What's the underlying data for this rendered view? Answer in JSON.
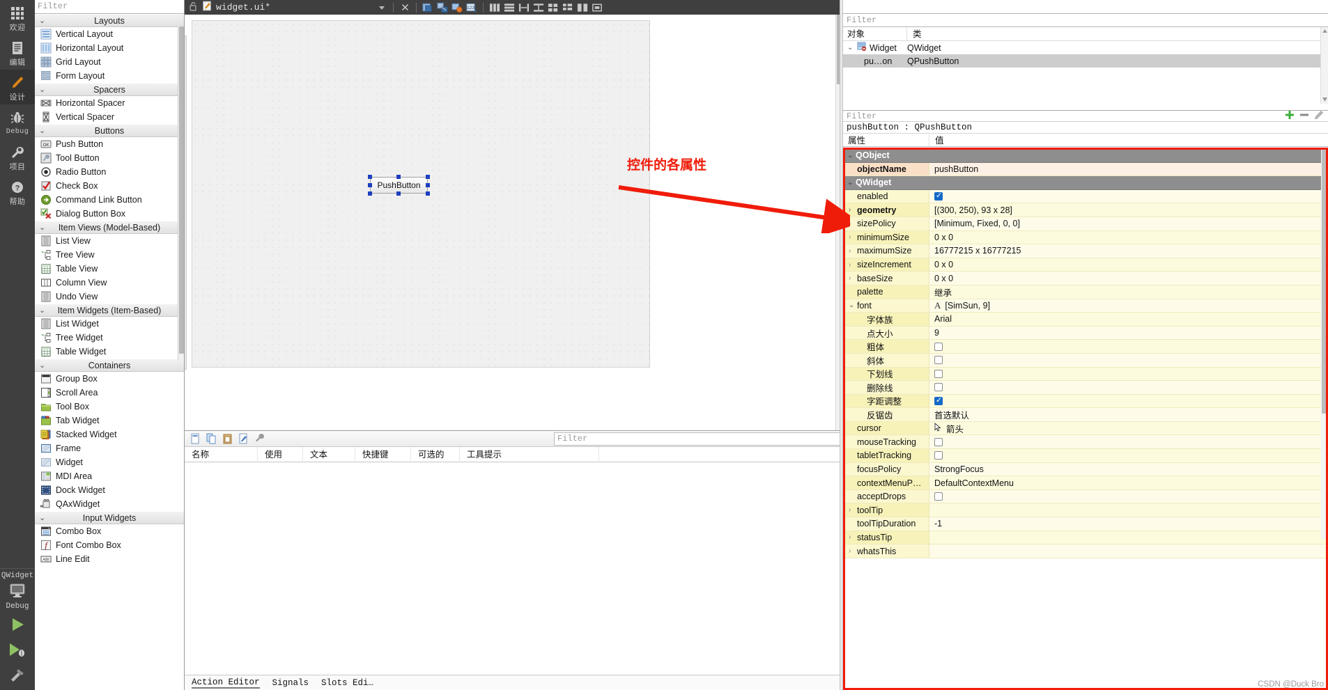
{
  "modebar": {
    "items": [
      {
        "label": "欢迎",
        "icon": "grid-icon",
        "active": false
      },
      {
        "label": "编辑",
        "icon": "document-icon",
        "active": false
      },
      {
        "label": "设计",
        "icon": "pencil-icon",
        "active": true
      },
      {
        "label": "Debug",
        "icon": "bug-icon",
        "active": false
      },
      {
        "label": "项目",
        "icon": "wrench-icon",
        "active": false
      },
      {
        "label": "帮助",
        "icon": "question-icon",
        "active": false
      }
    ],
    "kit": {
      "name": "QWidget",
      "build_config": "Debug",
      "icon": "monitor-icon"
    },
    "run_buttons": [
      {
        "name": "run-button",
        "icon": "play-icon"
      },
      {
        "name": "debug-button",
        "icon": "play-bug-icon"
      },
      {
        "name": "build-button",
        "icon": "hammer-icon"
      }
    ]
  },
  "widgetbox": {
    "filter_placeholder": "Filter",
    "groups": [
      {
        "title": "Layouts",
        "items": [
          {
            "label": "Vertical Layout",
            "icon": "vertical-layout-icon"
          },
          {
            "label": "Horizontal Layout",
            "icon": "horizontal-layout-icon"
          },
          {
            "label": "Grid Layout",
            "icon": "grid-layout-icon"
          },
          {
            "label": "Form Layout",
            "icon": "form-layout-icon"
          }
        ]
      },
      {
        "title": "Spacers",
        "items": [
          {
            "label": "Horizontal Spacer",
            "icon": "horizontal-spacer-icon"
          },
          {
            "label": "Vertical Spacer",
            "icon": "vertical-spacer-icon"
          }
        ]
      },
      {
        "title": "Buttons",
        "items": [
          {
            "label": "Push Button",
            "icon": "push-button-icon"
          },
          {
            "label": "Tool Button",
            "icon": "tool-button-icon"
          },
          {
            "label": "Radio Button",
            "icon": "radio-button-icon"
          },
          {
            "label": "Check Box",
            "icon": "check-box-icon"
          },
          {
            "label": "Command Link Button",
            "icon": "command-link-icon"
          },
          {
            "label": "Dialog Button Box",
            "icon": "dialog-button-box-icon"
          }
        ]
      },
      {
        "title": "Item Views (Model-Based)",
        "items": [
          {
            "label": "List View",
            "icon": "list-view-icon"
          },
          {
            "label": "Tree View",
            "icon": "tree-view-icon"
          },
          {
            "label": "Table View",
            "icon": "table-view-icon"
          },
          {
            "label": "Column View",
            "icon": "column-view-icon"
          },
          {
            "label": "Undo View",
            "icon": "undo-view-icon"
          }
        ]
      },
      {
        "title": "Item Widgets (Item-Based)",
        "items": [
          {
            "label": "List Widget",
            "icon": "list-widget-icon"
          },
          {
            "label": "Tree Widget",
            "icon": "tree-widget-icon"
          },
          {
            "label": "Table Widget",
            "icon": "table-widget-icon"
          }
        ]
      },
      {
        "title": "Containers",
        "items": [
          {
            "label": "Group Box",
            "icon": "group-box-icon"
          },
          {
            "label": "Scroll Area",
            "icon": "scroll-area-icon"
          },
          {
            "label": "Tool Box",
            "icon": "tool-box-icon"
          },
          {
            "label": "Tab Widget",
            "icon": "tab-widget-icon"
          },
          {
            "label": "Stacked Widget",
            "icon": "stacked-widget-icon"
          },
          {
            "label": "Frame",
            "icon": "frame-icon"
          },
          {
            "label": "Widget",
            "icon": "widget-icon"
          },
          {
            "label": "MDI Area",
            "icon": "mdi-area-icon"
          },
          {
            "label": "Dock Widget",
            "icon": "dock-widget-icon"
          },
          {
            "label": "QAxWidget",
            "icon": "qax-widget-icon"
          }
        ]
      },
      {
        "title": "Input Widgets",
        "items": [
          {
            "label": "Combo Box",
            "icon": "combo-box-icon"
          },
          {
            "label": "Font Combo Box",
            "icon": "font-combo-box-icon"
          },
          {
            "label": "Line Edit",
            "icon": "line-edit-icon"
          }
        ]
      }
    ]
  },
  "editor": {
    "file_name": "widget.ui*",
    "lock_icon": "unlocked-icon",
    "file_icon": "ui-file-icon",
    "dropdown_icon": "chevron-down-icon",
    "close_icon": "close-icon",
    "toolbar_buttons": [
      {
        "name": "edit-widgets-button",
        "icon": "edit-widgets-icon"
      },
      {
        "name": "edit-signals-slots-button",
        "icon": "edit-signals-slots-icon"
      },
      {
        "name": "edit-buddies-button",
        "icon": "edit-buddies-icon"
      },
      {
        "name": "edit-tab-order-button",
        "icon": "edit-tab-order-icon"
      },
      {
        "name": "layout-horizontally-button",
        "icon": "layout-horizontal-icon"
      },
      {
        "name": "layout-vertically-button",
        "icon": "layout-vertical-icon"
      },
      {
        "name": "layout-splitter-horizontal-button",
        "icon": "splitter-horizontal-icon"
      },
      {
        "name": "layout-splitter-vertical-button",
        "icon": "splitter-vertical-icon"
      },
      {
        "name": "layout-grid-button",
        "icon": "layout-grid-icon"
      },
      {
        "name": "layout-form-button",
        "icon": "layout-form-icon"
      },
      {
        "name": "break-layout-button",
        "icon": "break-layout-icon"
      },
      {
        "name": "adjust-size-button",
        "icon": "adjust-size-icon"
      }
    ],
    "form": {
      "selected_widget_text": "PushButton"
    }
  },
  "action_editor": {
    "toolbar_buttons": [
      {
        "name": "new-action-button",
        "icon": "new-file-icon"
      },
      {
        "name": "copy-action-button",
        "icon": "copy-icon"
      },
      {
        "name": "paste-action-button",
        "icon": "paste-icon"
      },
      {
        "name": "edit-action-button",
        "icon": "edit-icon"
      },
      {
        "name": "configure-button",
        "icon": "wrench-icon"
      }
    ],
    "filter_placeholder": "Filter",
    "columns": [
      "名称",
      "使用",
      "文本",
      "快捷键",
      "可选的",
      "工具提示"
    ],
    "rows": [],
    "tabs": [
      {
        "label": "Action Editor",
        "selected": true
      },
      {
        "label": "Signals",
        "selected": false
      },
      {
        "label": "Slots Edi…",
        "selected": false
      }
    ]
  },
  "object_inspector": {
    "filter_placeholder": "Filter",
    "columns": [
      "对象",
      "类"
    ],
    "rows": [
      {
        "object": "Widget",
        "class": "QWidget",
        "level": 0,
        "expanded": true,
        "selected": false,
        "icon": "widget-tree-icon"
      },
      {
        "object": "pu…on",
        "class": "QPushButton",
        "level": 1,
        "expanded": false,
        "selected": true,
        "icon": ""
      }
    ]
  },
  "property_editor": {
    "filter_placeholder": "Filter",
    "add_button_icon": "plus-icon",
    "remove_button_icon": "minus-icon",
    "configure_button_icon": "pencil-icon",
    "object_header": "pushButton : QPushButton",
    "columns": [
      "属性",
      "值"
    ],
    "rows": [
      {
        "kind": "group",
        "name": "QObject",
        "value": "",
        "indent": 0,
        "expander": "down"
      },
      {
        "kind": "modified",
        "name": "objectName",
        "value": "pushButton",
        "indent": 1,
        "expander": "none"
      },
      {
        "kind": "group",
        "name": "QWidget",
        "value": "",
        "indent": 0,
        "expander": "down"
      },
      {
        "kind": "prop",
        "name": "enabled",
        "value": "",
        "control": "checkbox-on",
        "indent": 1,
        "expander": "none"
      },
      {
        "kind": "bold",
        "name": "geometry",
        "value": "[(300, 250), 93 x 28]",
        "indent": 1,
        "expander": "right"
      },
      {
        "kind": "prop",
        "name": "sizePolicy",
        "value": "[Minimum, Fixed, 0, 0]",
        "indent": 1,
        "expander": "right"
      },
      {
        "kind": "prop",
        "name": "minimumSize",
        "value": "0 x 0",
        "indent": 1,
        "expander": "right"
      },
      {
        "kind": "prop",
        "name": "maximumSize",
        "value": "16777215 x 16777215",
        "indent": 1,
        "expander": "right"
      },
      {
        "kind": "prop",
        "name": "sizeIncrement",
        "value": "0 x 0",
        "indent": 1,
        "expander": "right"
      },
      {
        "kind": "prop",
        "name": "baseSize",
        "value": "0 x 0",
        "indent": 1,
        "expander": "right"
      },
      {
        "kind": "prop",
        "name": "palette",
        "value": "继承",
        "indent": 1,
        "expander": "none"
      },
      {
        "kind": "prop",
        "name": "font",
        "value": "[SimSun, 9]",
        "control": "font-glyph",
        "indent": 1,
        "expander": "down"
      },
      {
        "kind": "prop",
        "name": "字体族",
        "value": "Arial",
        "indent": 2,
        "expander": "none"
      },
      {
        "kind": "prop",
        "name": "点大小",
        "value": "9",
        "indent": 2,
        "expander": "none"
      },
      {
        "kind": "prop",
        "name": "粗体",
        "value": "",
        "control": "checkbox-off",
        "indent": 2,
        "expander": "none"
      },
      {
        "kind": "prop",
        "name": "斜体",
        "value": "",
        "control": "checkbox-off",
        "indent": 2,
        "expander": "none"
      },
      {
        "kind": "prop",
        "name": "下划线",
        "value": "",
        "control": "checkbox-off",
        "indent": 2,
        "expander": "none"
      },
      {
        "kind": "prop",
        "name": "删除线",
        "value": "",
        "control": "checkbox-off",
        "indent": 2,
        "expander": "none"
      },
      {
        "kind": "prop",
        "name": "字距调整",
        "value": "",
        "control": "checkbox-on",
        "indent": 2,
        "expander": "none"
      },
      {
        "kind": "prop",
        "name": "反锯齿",
        "value": "首选默认",
        "indent": 2,
        "expander": "none"
      },
      {
        "kind": "prop",
        "name": "cursor",
        "value": "箭头",
        "control": "cursor-glyph",
        "indent": 1,
        "expander": "none"
      },
      {
        "kind": "prop",
        "name": "mouseTracking",
        "value": "",
        "control": "checkbox-off",
        "indent": 1,
        "expander": "none"
      },
      {
        "kind": "prop",
        "name": "tabletTracking",
        "value": "",
        "control": "checkbox-off",
        "indent": 1,
        "expander": "none"
      },
      {
        "kind": "prop",
        "name": "focusPolicy",
        "value": "StrongFocus",
        "indent": 1,
        "expander": "none"
      },
      {
        "kind": "prop",
        "name": "contextMenuP…",
        "value": "DefaultContextMenu",
        "indent": 1,
        "expander": "none"
      },
      {
        "kind": "prop",
        "name": "acceptDrops",
        "value": "",
        "control": "checkbox-off",
        "indent": 1,
        "expander": "none"
      },
      {
        "kind": "prop",
        "name": "toolTip",
        "value": "",
        "indent": 1,
        "expander": "right"
      },
      {
        "kind": "prop",
        "name": "toolTipDuration",
        "value": "-1",
        "indent": 1,
        "expander": "none"
      },
      {
        "kind": "prop",
        "name": "statusTip",
        "value": "",
        "indent": 1,
        "expander": "right"
      },
      {
        "kind": "prop",
        "name": "whatsThis",
        "value": "",
        "indent": 1,
        "expander": "right"
      }
    ]
  },
  "annotation": {
    "text": "控件的各属性",
    "color": "#f01c0a"
  },
  "watermark": {
    "text": "CSDN @Duck Bro"
  },
  "colors": {
    "modebar_bg": "#3f3f3f",
    "highlight_red": "#f01c0a",
    "property_yellow": "#f7f2b8",
    "property_group": "#8e8e8e",
    "modified_orange": "#fbe0c8",
    "selection_blue": "#1f3fbf"
  }
}
